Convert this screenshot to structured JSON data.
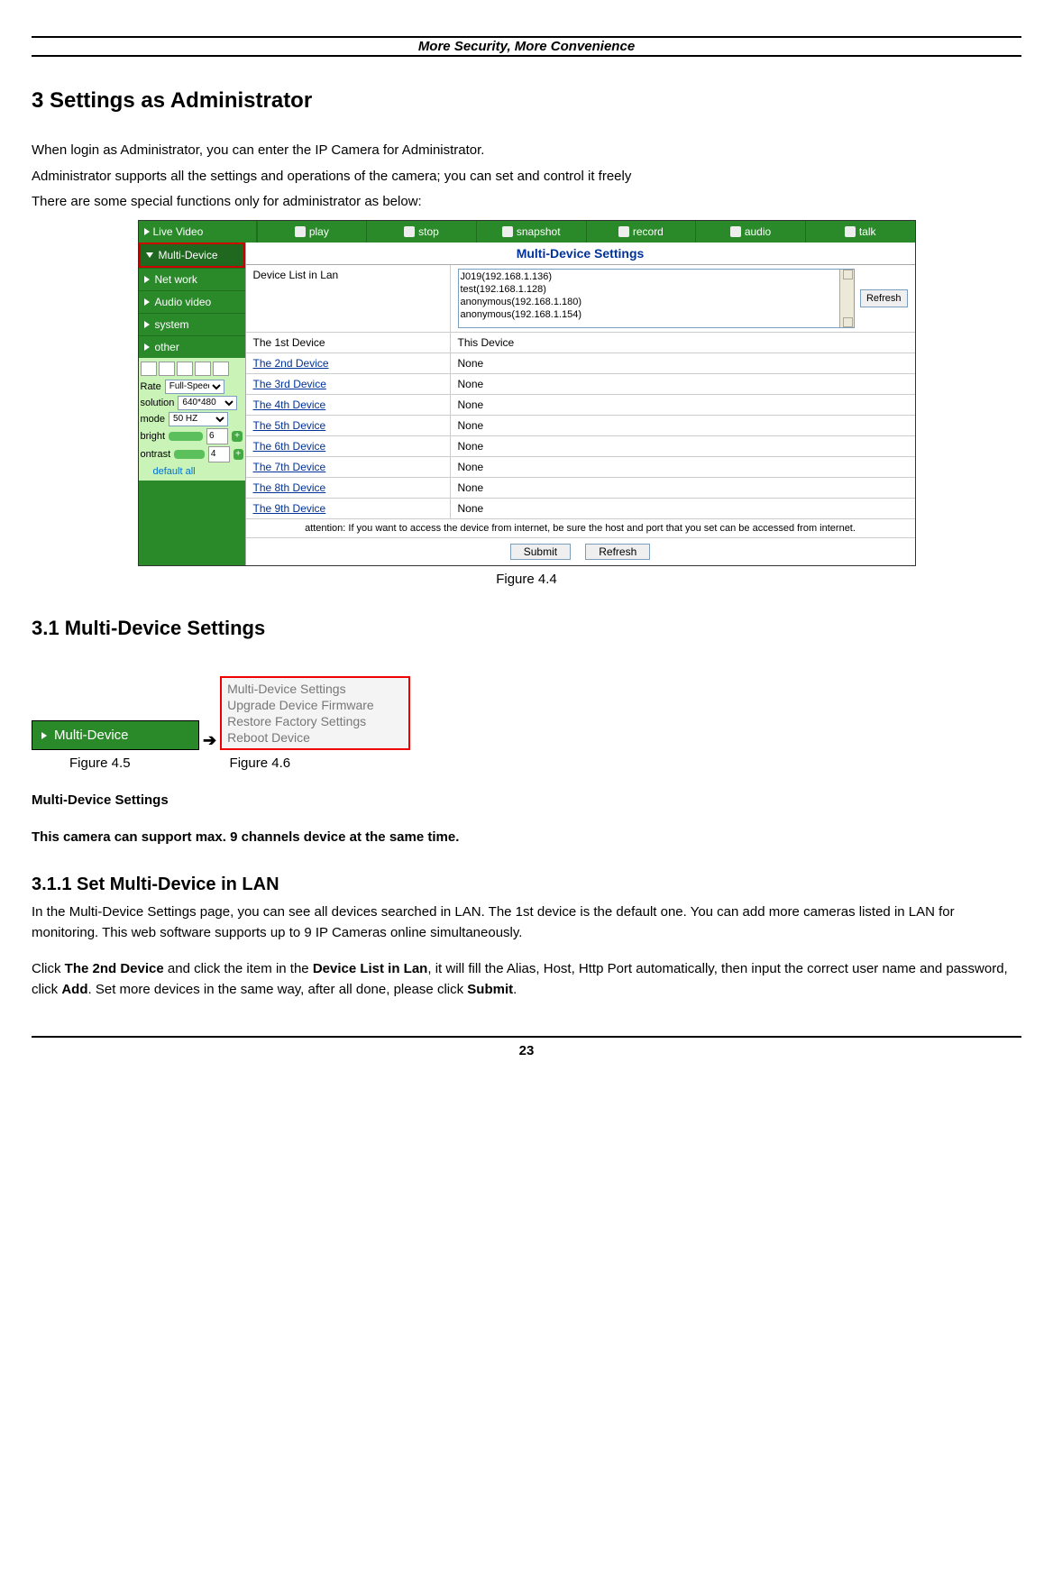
{
  "header": "More Security, More Convenience",
  "h3": "3 Settings as Administrator",
  "p1": "When login as Administrator, you can enter the IP Camera for Administrator.",
  "p2": "Administrator supports all the settings and operations of the camera; you can set and control it freely",
  "p3": "There are some special functions only for administrator as below:",
  "sc1": {
    "top": {
      "live": "Live Video",
      "play": "play",
      "stop": "stop",
      "snap": "snapshot",
      "rec": "record",
      "audio": "audio",
      "talk": "talk"
    },
    "side": [
      "Multi-Device",
      "Net work",
      "Audio video",
      "system",
      "other"
    ],
    "foot": {
      "rate_l": "Rate",
      "rate_v": "Full-Speed",
      "res_l": "solution",
      "res_v": "640*480",
      "mode_l": "mode",
      "mode_v": "50 HZ",
      "bri_l": "bright",
      "bri_v": "6",
      "con_l": "ontrast",
      "con_v": "4",
      "def": "default all"
    },
    "title": "Multi-Device Settings",
    "lanlab": "Device List in Lan",
    "lan": "J019(192.168.1.136)\ntest(192.168.1.128)\nanonymous(192.168.1.180)\nanonymous(192.168.1.154)",
    "refresh": "Refresh",
    "devs": [
      {
        "l": "The 1st Device",
        "v": "This Device",
        "lk": false
      },
      {
        "l": "The 2nd Device",
        "v": "None",
        "lk": true
      },
      {
        "l": "The 3rd Device",
        "v": "None",
        "lk": true
      },
      {
        "l": "The 4th Device",
        "v": "None",
        "lk": true
      },
      {
        "l": "The 5th Device",
        "v": "None",
        "lk": true
      },
      {
        "l": "The 6th Device",
        "v": "None",
        "lk": true
      },
      {
        "l": "The 7th Device",
        "v": "None",
        "lk": true
      },
      {
        "l": "The 8th Device",
        "v": "None",
        "lk": true
      },
      {
        "l": "The 9th Device",
        "v": "None",
        "lk": true
      }
    ],
    "attn": "attention: If you want to access the device from internet, be sure the host and port that you set can be accessed from internet.",
    "submit": "Submit",
    "refresh2": "Refresh"
  },
  "fig44": "Figure 4.4",
  "h31": "3.1 Multi-Device Settings",
  "fig45tab": "Multi-Device",
  "menu46": [
    "Multi-Device Settings",
    "Upgrade Device Firmware",
    "Restore Factory Settings",
    "Reboot Device"
  ],
  "fig45": "Figure 4.5",
  "fig46": "Figure 4.6",
  "mds": "Multi-Device Settings",
  "mds2": "This camera can support max. 9 channels device at the same time.",
  "h311": "3.1.1 Set Multi-Device in LAN",
  "p311a": "In the Multi-Device Settings page, you can see all devices searched in LAN. The 1st device is the default one. You can add more cameras listed in LAN for monitoring. This web software supports up to 9 IP Cameras online simultaneously.",
  "p311b_1": "Click ",
  "p311b_2": "The 2nd Device",
  "p311b_3": " and click the item in the ",
  "p311b_4": "Device List in Lan",
  "p311b_5": ", it will fill the Alias, Host, Http Port automatically, then input the correct user name and password, click ",
  "p311b_6": "Add",
  "p311b_7": ". Set more devices in the same way, after all done, please click ",
  "p311b_8": "Submit",
  "p311b_9": ".",
  "page": "23"
}
